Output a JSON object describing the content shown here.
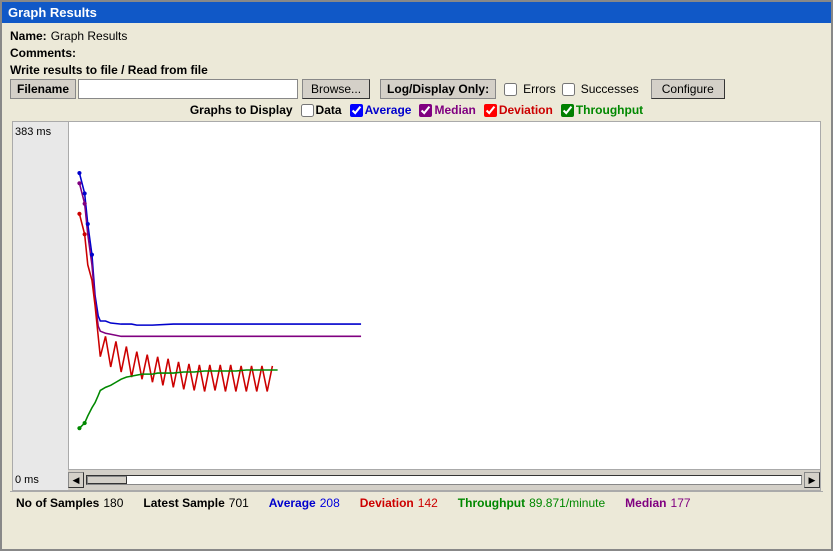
{
  "window": {
    "title": "Graph Results"
  },
  "form": {
    "name_label": "Name:",
    "name_value": "Graph Results",
    "comments_label": "Comments:",
    "write_label": "Write results to file / Read from file",
    "filename_label": "Filename",
    "filename_value": "",
    "filename_placeholder": "",
    "browse_label": "Browse...",
    "log_display_label": "Log/Display Only:",
    "errors_label": "Errors",
    "successes_label": "Successes",
    "configure_label": "Configure"
  },
  "graphs": {
    "label": "Graphs to Display",
    "data_label": "Data",
    "average_label": "Average",
    "median_label": "Median",
    "deviation_label": "Deviation",
    "throughput_label": "Throughput",
    "data_checked": false,
    "average_checked": true,
    "median_checked": true,
    "deviation_checked": true,
    "throughput_checked": true
  },
  "chart": {
    "y_top": "383 ms",
    "y_bottom": "0 ms"
  },
  "stats": {
    "no_samples_label": "No of Samples",
    "no_samples_value": "180",
    "latest_sample_label": "Latest Sample",
    "latest_sample_value": "701",
    "average_label": "Average",
    "average_value": "208",
    "deviation_label": "Deviation",
    "deviation_value": "142",
    "throughput_label": "Throughput",
    "throughput_value": "89.871/minute",
    "median_label": "Median",
    "median_value": "177"
  }
}
